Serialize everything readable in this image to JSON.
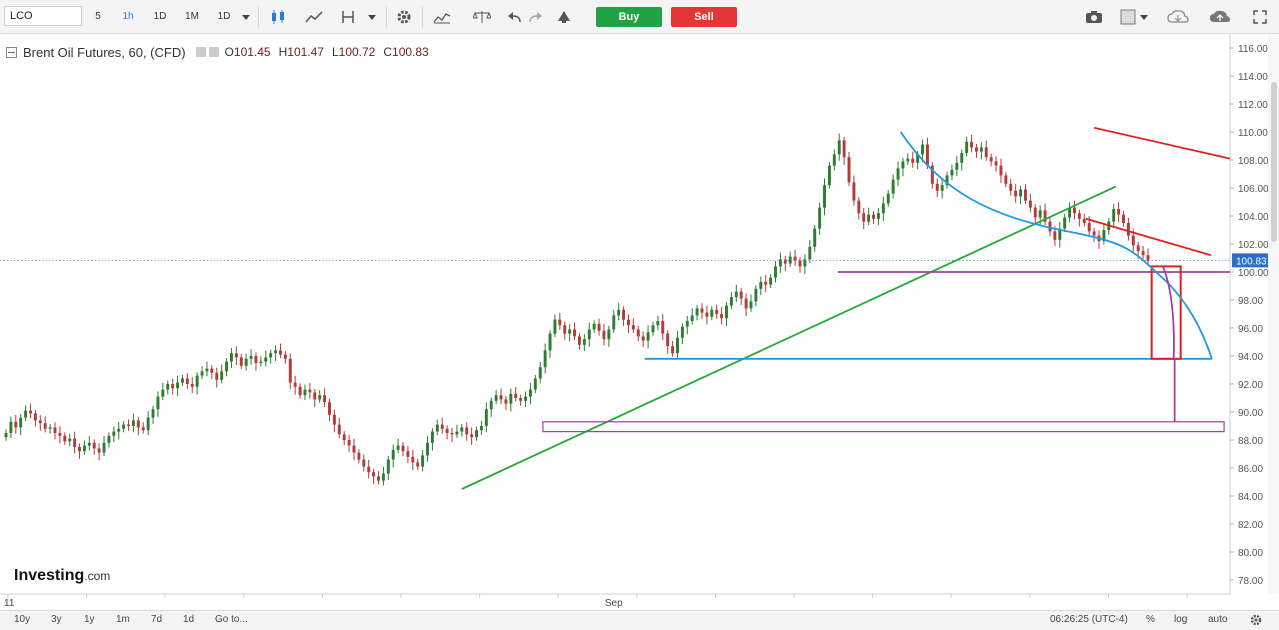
{
  "toolbar": {
    "symbol": "LCO",
    "intervals": [
      "5",
      "1h",
      "1D",
      "1M",
      "1D"
    ],
    "active_interval": "1h",
    "buy_label": "Buy",
    "sell_label": "Sell"
  },
  "legend": {
    "title": "Brent Oil Futures, 60, (CFD)",
    "o_label": "O",
    "o_value": "101.45",
    "h_label": "H",
    "h_value": "101.47",
    "l_label": "L",
    "l_value": "100.72",
    "c_label": "C",
    "c_value": "100.83"
  },
  "brand": {
    "logo": "Investing",
    "suffix": ".com"
  },
  "bottombar": {
    "ranges": [
      "10y",
      "3y",
      "1y",
      "1m",
      "7d",
      "1d",
      "Go to..."
    ],
    "time": "06:26:25 (UTC-4)",
    "pct": "%",
    "log": "log",
    "auto": "auto"
  },
  "chart_data": {
    "type": "candlestick",
    "title": "Brent Oil Futures, 60, (CFD)",
    "ylim": [
      77,
      117
    ],
    "yticks": [
      "78.00",
      "80.00",
      "82.00",
      "84.00",
      "86.00",
      "88.00",
      "90.00",
      "92.00",
      "94.00",
      "96.00",
      "98.00",
      "100.00",
      "102.00",
      "104.00",
      "106.00",
      "108.00",
      "110.00",
      "112.00",
      "114.00",
      "116.00"
    ],
    "xlabels": [
      {
        "label": "11",
        "pos": 0.0
      },
      {
        "label": "Sep",
        "pos": 0.4885
      }
    ],
    "last_price": "100.83",
    "colors": {
      "up": "#2e7d32",
      "down": "#b33b3b",
      "red_line": "#e02020",
      "green_line": "#22aa33",
      "blue_line": "#1e9be0",
      "purple_line": "#a040a0"
    },
    "closes": [
      88.5,
      89.3,
      88.9,
      89.6,
      90.1,
      89.9,
      89.4,
      89.2,
      88.8,
      88.9,
      88.5,
      88.3,
      87.9,
      88.1,
      87.5,
      87.2,
      87.6,
      87.8,
      87.4,
      87.1,
      87.8,
      88.3,
      88.6,
      88.8,
      89.1,
      89.0,
      89.4,
      88.9,
      88.7,
      89.6,
      90.2,
      91.1,
      91.6,
      92.0,
      91.7,
      92.1,
      92.4,
      92.0,
      91.8,
      92.6,
      92.9,
      93.1,
      92.8,
      92.3,
      92.9,
      93.6,
      94.2,
      93.9,
      93.3,
      93.8,
      94.0,
      93.5,
      93.6,
      93.9,
      94.2,
      94.4,
      94.1,
      93.8,
      92.1,
      91.8,
      91.2,
      91.6,
      91.4,
      90.9,
      91.2,
      90.7,
      89.8,
      89.1,
      88.4,
      88.0,
      87.6,
      87.1,
      86.6,
      86.1,
      85.7,
      85.4,
      85.1,
      85.6,
      86.6,
      87.3,
      87.6,
      87.2,
      86.8,
      86.4,
      86.1,
      86.9,
      87.8,
      88.6,
      89.1,
      88.8,
      88.5,
      88.4,
      88.6,
      88.9,
      88.4,
      88.2,
      88.7,
      89.0,
      90.2,
      90.8,
      91.2,
      90.9,
      90.6,
      91.3,
      91.0,
      90.8,
      91.1,
      91.6,
      92.4,
      93.2,
      94.4,
      95.6,
      96.6,
      96.2,
      95.6,
      95.9,
      95.4,
      94.8,
      95.2,
      95.9,
      96.3,
      95.8,
      95.2,
      95.9,
      96.9,
      97.3,
      96.6,
      96.2,
      95.9,
      95.4,
      95.1,
      95.7,
      96.2,
      96.5,
      95.6,
      94.7,
      94.2,
      95.3,
      96.1,
      96.5,
      96.9,
      97.4,
      97.1,
      96.8,
      97.3,
      97.0,
      96.7,
      97.6,
      98.2,
      98.6,
      98.1,
      97.4,
      97.9,
      98.8,
      99.3,
      99.1,
      99.6,
      100.4,
      100.9,
      100.6,
      101.1,
      100.8,
      100.4,
      100.9,
      101.8,
      103.1,
      104.6,
      106.2,
      107.6,
      108.4,
      109.4,
      108.2,
      106.4,
      105.1,
      104.2,
      103.6,
      104.1,
      103.8,
      104.2,
      104.9,
      105.6,
      106.6,
      107.4,
      107.9,
      108.1,
      107.8,
      108.4,
      109.1,
      107.6,
      106.3,
      105.8,
      106.2,
      106.9,
      107.3,
      107.8,
      108.5,
      109.3,
      108.9,
      108.6,
      108.9,
      108.2,
      107.9,
      107.6,
      106.9,
      106.3,
      105.8,
      105.4,
      105.9,
      105.1,
      104.6,
      103.9,
      104.4,
      103.6,
      102.9,
      102.3,
      103.1,
      103.9,
      104.6,
      104.2,
      103.8,
      103.5,
      102.9,
      102.6,
      102.2,
      103.0,
      103.6,
      104.5,
      104.1,
      103.5,
      102.6,
      101.9,
      101.5,
      101.2,
      100.8
    ],
    "annotations": [
      {
        "type": "line",
        "color": "red",
        "points": [
          [
            0.8895,
            110.3
          ],
          [
            1.0,
            108.1
          ]
        ]
      },
      {
        "type": "line",
        "color": "red",
        "points": [
          [
            0.8829,
            103.8
          ],
          [
            0.9845,
            101.2
          ]
        ]
      },
      {
        "type": "line",
        "color": "green",
        "points": [
          [
            0.3755,
            84.5
          ],
          [
            0.9071,
            106.1
          ]
        ]
      },
      {
        "type": "hline",
        "color": "blue",
        "y": 93.8,
        "x": [
          0.5242,
          0.9853
        ]
      },
      {
        "type": "hline",
        "color": "purple",
        "y": 100.0,
        "x": [
          0.6811,
          1.0
        ]
      },
      {
        "type": "rect",
        "color": "purple",
        "y": [
          88.6,
          89.3
        ],
        "x": [
          0.4414,
          0.9952
        ]
      },
      {
        "type": "rect",
        "color": "red",
        "y": [
          93.8,
          100.4
        ],
        "x": [
          0.9363,
          0.9599
        ]
      },
      {
        "type": "curve",
        "color": "blue",
        "from": [
          0.7323,
          110.0
        ],
        "to": [
          0.9853,
          93.8
        ]
      },
      {
        "type": "curve",
        "color": "purple",
        "from": [
          0.9455,
          100.4
        ],
        "to": [
          0.9542,
          93.8
        ]
      },
      {
        "type": "vline",
        "color": "purple",
        "x": 0.955,
        "y": [
          89.3,
          93.8
        ]
      }
    ]
  }
}
